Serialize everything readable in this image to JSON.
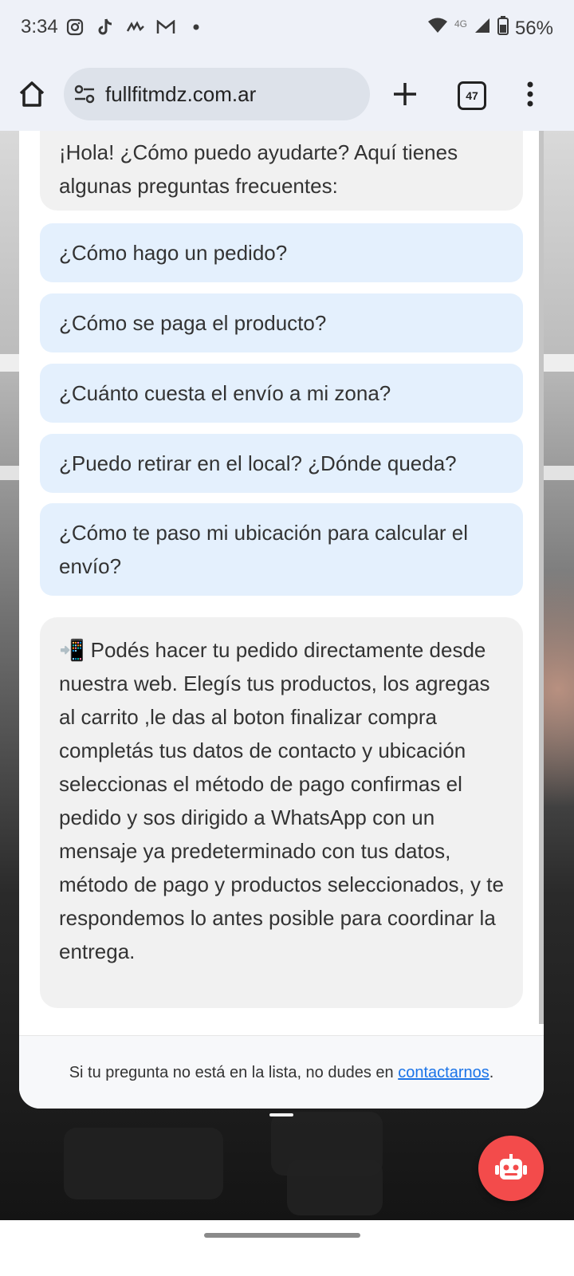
{
  "status_bar": {
    "time": "3:34",
    "battery": "56%",
    "network": "4G",
    "icons": [
      "instagram-icon",
      "tiktok-icon",
      "squiggle-icon",
      "gmail-icon",
      "dot-icon",
      "wifi-icon",
      "signal-icon",
      "battery-icon"
    ]
  },
  "browser": {
    "url": "fullfitmdz.com.ar",
    "tab_count": "47"
  },
  "chat": {
    "greeting": "¡Hola! ¿Cómo puedo ayudarte? Aquí tienes algunas preguntas frecuentes:",
    "faqs": [
      "¿Cómo hago un pedido?",
      "¿Cómo se paga el producto?",
      "¿Cuánto cuesta el envío a mi zona?",
      "¿Puedo retirar en el local? ¿Dónde queda?",
      "¿Cómo te paso mi ubicación para calcular el envío?"
    ],
    "answer": "📲 Podés hacer tu pedido directamente desde nuestra web. Elegís tus productos, los agregas al carrito ,le das al boton finalizar compra completás tus datos de contacto y ubicación seleccionas el método de pago confirmas el pedido y sos dirigido a WhatsApp con un mensaje ya predeterminado con tus datos, método de pago y productos seleccionados, y te respondemos lo antes posible para coordinar la entrega.",
    "footer_prefix": "Si tu pregunta no está en la lista, no dudes en ",
    "footer_link": "contactarnos",
    "footer_suffix": "."
  },
  "colors": {
    "accent_fab": "#f34b4b",
    "faq_bg": "#e4f0fd",
    "link": "#1a73e8"
  }
}
